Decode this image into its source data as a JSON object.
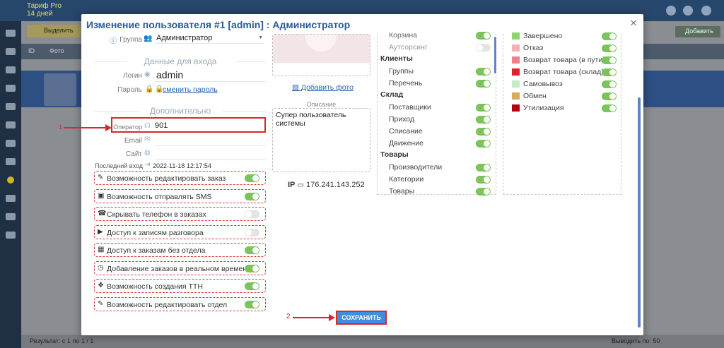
{
  "app": {
    "brand": [
      "Тариф Pro",
      "14 дней"
    ],
    "toolbar_left": "Выделить",
    "toolbar_right": "Добавить",
    "table_head": [
      "ID",
      "Фото"
    ],
    "footer_left": "Результат: с 1 по 1 / 1",
    "footer_right": "Выводить по: 50"
  },
  "modal": {
    "title": "Изменение пользователя #1 [admin] : Администратор",
    "close": "×",
    "group_label": "Группа",
    "group_value": "Администратор",
    "login_section": "Данные для входа",
    "login_label": "Логин",
    "login_value": "admin",
    "password_label": "Пароль",
    "password_link": "сменить пароль",
    "extra_section": "Дополнительно",
    "operator_label": "Оператор",
    "operator_value": "901",
    "email_label": "Email",
    "site_label": "Сайт",
    "last_login_label": "Последний вход",
    "last_login_value": "2022-11-18 12:17:54",
    "permissions": [
      {
        "label": "Возможность редактировать заказ",
        "icon": "pencil-icon",
        "glyph": "✎",
        "on": true
      },
      {
        "label": "Возможность отправлять SMS",
        "icon": "sms-icon",
        "glyph": "▣",
        "on": true
      },
      {
        "label": "Скрывать телефон в заказах",
        "icon": "phone-icon",
        "glyph": "☎",
        "on": false
      },
      {
        "label": "Доступ к записям разговора",
        "icon": "play-icon",
        "glyph": "▶",
        "on": false
      },
      {
        "label": "Доступ к заказам без отдела",
        "icon": "building-icon",
        "glyph": "▦",
        "on": true
      },
      {
        "label": "Добавление заказов в реальном времени",
        "icon": "clock-icon",
        "glyph": "◷",
        "on": true
      },
      {
        "label": "Возможность создания ТТН",
        "icon": "dropbox-icon",
        "glyph": "❖",
        "on": true
      },
      {
        "label": "Возможность редактировать отдел",
        "icon": "pencil-icon",
        "glyph": "✎",
        "on": true
      }
    ],
    "add_photo": "Добавить фото",
    "description_label": "Описание",
    "description_value": "Супер пользователь системы",
    "ip_label": "IP",
    "ip_value": "176.241.143.252",
    "save": "СОХРАНИТЬ",
    "annotation_1": "1",
    "annotation_2": "2"
  },
  "access_list": [
    {
      "type": "item",
      "label": "Корзина",
      "on": true
    },
    {
      "type": "item",
      "label": "Аутсорсинг",
      "on": false
    },
    {
      "type": "head",
      "label": "Клиенты"
    },
    {
      "type": "item",
      "label": "Группы",
      "on": true
    },
    {
      "type": "item",
      "label": "Перечень",
      "on": true
    },
    {
      "type": "head",
      "label": "Склад"
    },
    {
      "type": "item",
      "label": "Поставщики",
      "on": true
    },
    {
      "type": "item",
      "label": "Приход",
      "on": true
    },
    {
      "type": "item",
      "label": "Списание",
      "on": true
    },
    {
      "type": "item",
      "label": "Движение",
      "on": true
    },
    {
      "type": "head",
      "label": "Товары"
    },
    {
      "type": "item",
      "label": "Производители",
      "on": true
    },
    {
      "type": "item",
      "label": "Категории",
      "on": true
    },
    {
      "type": "item",
      "label": "Товары",
      "on": true
    }
  ],
  "status_list": [
    {
      "label": "Завершено",
      "color": "#8fd46a",
      "on": true
    },
    {
      "label": "Отказ",
      "color": "#f4b2b8",
      "on": true
    },
    {
      "label": "Возврат товара (в пути)",
      "color": "#f0808a",
      "on": true
    },
    {
      "label": "Возврат товара (склад)",
      "color": "#e0202a",
      "on": true
    },
    {
      "label": "Самовывоз",
      "color": "#c5ecc4",
      "on": true
    },
    {
      "label": "Обмен",
      "color": "#d9aa5c",
      "on": true
    },
    {
      "label": "Утилизация",
      "color": "#b80010",
      "on": true
    }
  ]
}
